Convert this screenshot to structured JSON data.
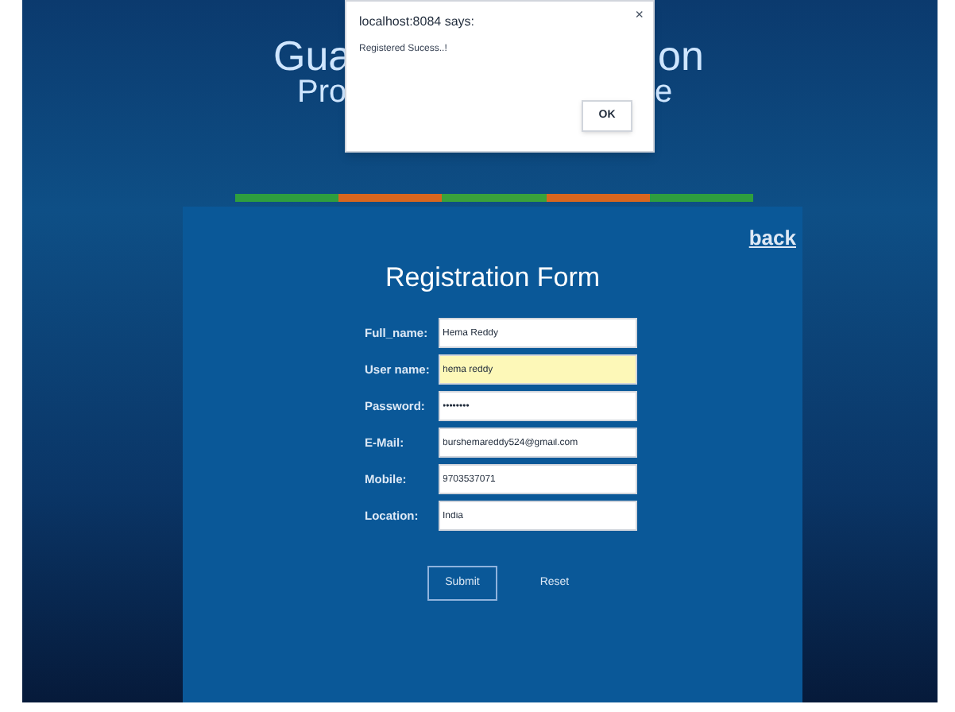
{
  "banner": {
    "title_left": "Gua",
    "title_right": "on",
    "subtitle_left": "Pro",
    "subtitle_right": "e"
  },
  "alert": {
    "origin": "localhost:8084 says:",
    "message": "Registered Sucess..!",
    "close": "×",
    "ok": "OK"
  },
  "color_bar": [
    {
      "color": "#2e9e3e"
    },
    {
      "color": "#d8661e"
    },
    {
      "color": "#3aa23a"
    },
    {
      "color": "#d8661e"
    },
    {
      "color": "#2e9e3e"
    }
  ],
  "form": {
    "back": "back",
    "title": "Registration Form",
    "fields": [
      {
        "label": "Full_name:",
        "value": "Hema Reddy",
        "focused": false
      },
      {
        "label": "User name:",
        "value": "hema reddy",
        "focused": true
      },
      {
        "label": "Password:",
        "value": "••••••••",
        "focused": false
      },
      {
        "label": "E-Mail:",
        "value": "burshemareddy524@gmail.com",
        "focused": false
      },
      {
        "label": "Mobile:",
        "value": "9703537071",
        "focused": false
      },
      {
        "label": "Location:",
        "value": "India",
        "focused": false
      }
    ],
    "buttons": [
      {
        "label": "Submit",
        "kind": "outlined"
      },
      {
        "label": "Reset",
        "kind": "plain"
      }
    ]
  }
}
